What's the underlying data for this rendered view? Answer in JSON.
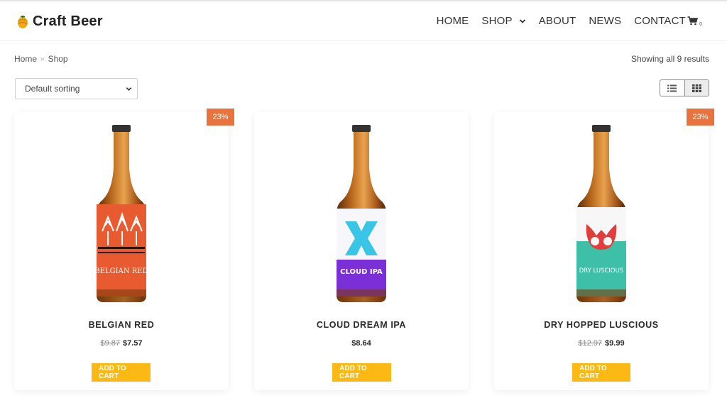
{
  "brand": {
    "name": "Craft Beer",
    "logo_icon": "hop-icon",
    "accent_color": "#f4a818"
  },
  "nav": {
    "items": [
      {
        "label": "HOME"
      },
      {
        "label": "SHOP",
        "has_dropdown": true
      },
      {
        "label": "ABOUT"
      },
      {
        "label": "NEWS"
      },
      {
        "label": "CONTACT"
      }
    ],
    "cart_icon": "cart-icon",
    "cart_count": "0"
  },
  "breadcrumb": {
    "home": "Home",
    "separator": "»",
    "current": "Shop"
  },
  "results_text": "Showing all 9 results",
  "sort": {
    "selected": "Default sorting"
  },
  "view_toggle": {
    "list_icon": "list-view-icon",
    "grid_icon": "grid-view-icon",
    "active": "grid"
  },
  "products": [
    {
      "title": "BELGIAN RED",
      "old_price": "$9.87",
      "price": "$7.57",
      "badge": "23%",
      "button": "ADD TO CART",
      "label_text": "BELGIAN RED",
      "label_color": "#e85a2f"
    },
    {
      "title": "CLOUD DREAM IPA",
      "old_price": "",
      "price": "$8.64",
      "badge": "",
      "button": "ADD TO CART",
      "label_text": "CLOUD IPA",
      "label_color": "#7b2fd6"
    },
    {
      "title": "DRY HOPPED LUSCIOUS",
      "old_price": "$12.97",
      "price": "$9.99",
      "badge": "23%",
      "button": "ADD TO CART",
      "label_text": "DRY LUSCIOUS",
      "label_color": "#3dbfa8"
    }
  ],
  "colors": {
    "badge": "#e8733e",
    "button": "#fcb813"
  }
}
